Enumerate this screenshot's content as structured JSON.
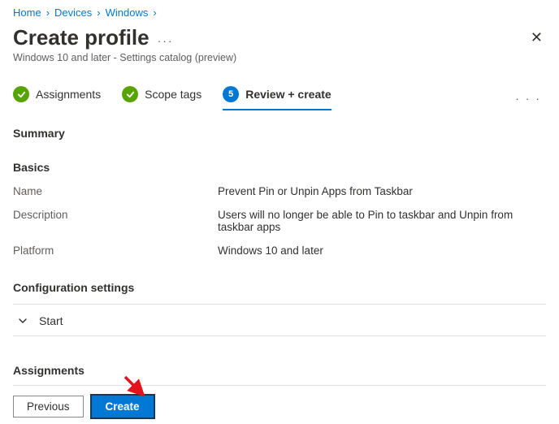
{
  "breadcrumb": {
    "home": "Home",
    "devices": "Devices",
    "windows": "Windows"
  },
  "header": {
    "title": "Create profile",
    "subtitle": "Windows 10 and later - Settings catalog (preview)"
  },
  "tabs": {
    "assignments": "Assignments",
    "scopetags": "Scope tags",
    "review_step_num": "5",
    "review": "Review + create"
  },
  "sections": {
    "summary": "Summary",
    "basics": "Basics",
    "config_settings": "Configuration settings",
    "start": "Start",
    "assignments": "Assignments"
  },
  "basics": {
    "name_label": "Name",
    "name_value": "Prevent Pin or Unpin Apps from Taskbar",
    "desc_label": "Description",
    "desc_value": "Users will no longer be able to Pin to taskbar and Unpin from taskbar apps",
    "platform_label": "Platform",
    "platform_value": "Windows 10 and later"
  },
  "footer": {
    "previous": "Previous",
    "create": "Create"
  }
}
